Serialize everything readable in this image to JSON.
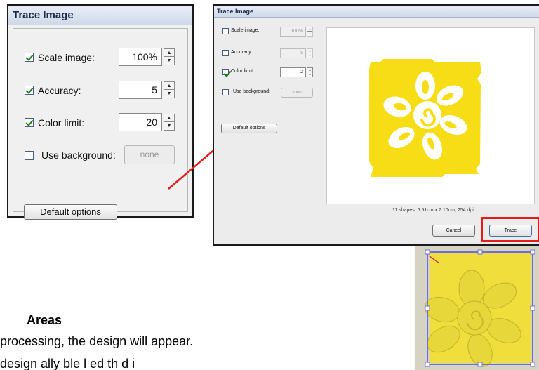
{
  "left_panel": {
    "title": "Trace Image",
    "scale_image": {
      "label": "Scale image:",
      "value": "100%",
      "checked": true
    },
    "accuracy": {
      "label": "Accuracy:",
      "value": "5",
      "checked": true
    },
    "color_limit": {
      "label": "Color limit:",
      "value": "20",
      "checked": true
    },
    "use_background": {
      "label": "Use background:",
      "button": "none",
      "checked": false
    },
    "default_options": "Default options"
  },
  "right_dialog": {
    "title": "Trace Image",
    "scale_image": {
      "label": "Scale image:",
      "value": "100%",
      "checked": false
    },
    "accuracy": {
      "label": "Accuracy:",
      "value": "5",
      "checked": false
    },
    "color_limit": {
      "label": "Color limit:",
      "value": "2",
      "checked": true
    },
    "use_background": {
      "label": "Use background:",
      "button": "none",
      "checked": false
    },
    "default_options": "Default options",
    "status": "11 shapes, 6.51cm x 7.10cm, 254 dpi",
    "cancel": "Cancel",
    "trace": "Trace"
  },
  "document": {
    "heading": "Areas",
    "line1": "processing, the design will appear.",
    "line2": "design     ally   ble  l    ed th  d  i"
  },
  "colors": {
    "highlight": "#e21b1b",
    "arrow": "#e21b1b",
    "flower_yellow": "#f7dd16",
    "selection": "#6a6ee0"
  }
}
